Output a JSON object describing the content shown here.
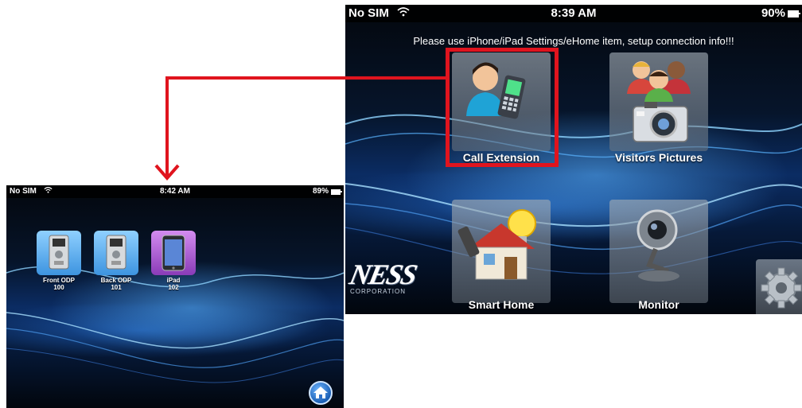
{
  "right_screen": {
    "status": {
      "carrier": "No SIM",
      "time": "8:39 AM",
      "battery": "90%"
    },
    "notice": "Please use iPhone/iPad Settings/eHome item, setup connection info!!!",
    "tiles": [
      {
        "label": "Call Extension",
        "icon": "call-extension-icon"
      },
      {
        "label": "Visitors Pictures",
        "icon": "visitors-camera-icon"
      },
      {
        "label": "Smart Home",
        "icon": "smart-home-icon"
      },
      {
        "label": "Monitor",
        "icon": "webcam-icon"
      }
    ],
    "brand": {
      "logo": "NESS",
      "tagline": "CORPORATION"
    },
    "settings_icon": "gear-icon"
  },
  "left_screen": {
    "status": {
      "carrier": "No SIM",
      "time": "8:42 AM",
      "battery": "89%"
    },
    "extensions": [
      {
        "name": "Front ODP",
        "number": "100",
        "icon": "door-phone-icon"
      },
      {
        "name": "Back ODP",
        "number": "101",
        "icon": "door-phone-icon"
      },
      {
        "name": "iPad",
        "number": "102",
        "icon": "ipad-icon"
      }
    ],
    "home_icon": "home-icon"
  },
  "colors": {
    "highlight": "#e0141e",
    "arrow": "#e0141e"
  }
}
